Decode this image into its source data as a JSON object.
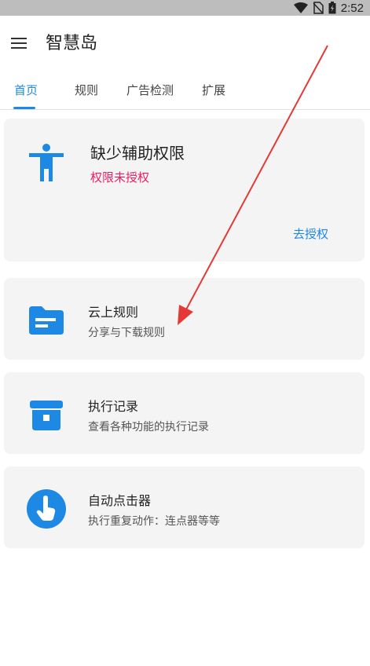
{
  "status": {
    "time": "2:52"
  },
  "app": {
    "title": "智慧岛"
  },
  "tabs": [
    {
      "label": "首页"
    },
    {
      "label": "规则"
    },
    {
      "label": "广告检测"
    },
    {
      "label": "扩展"
    }
  ],
  "permission_card": {
    "title": "缺少辅助权限",
    "subtitle": "权限未授权",
    "action": "去授权"
  },
  "rows": [
    {
      "title": "云上规则",
      "subtitle": "分享与下载规则",
      "icon": "folder-icon"
    },
    {
      "title": "执行记录",
      "subtitle": "查看各种功能的执行记录",
      "icon": "archive-icon"
    },
    {
      "title": "自动点击器",
      "subtitle": "执行重复动作：连点器等等",
      "icon": "touch-icon"
    }
  ],
  "colors": {
    "accent": "#1e88e5",
    "warning": "#e91e63",
    "annotation_arrow": "#e53935"
  }
}
